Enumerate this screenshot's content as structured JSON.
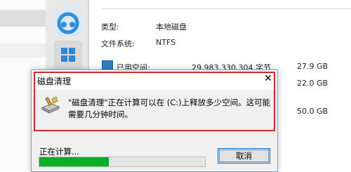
{
  "properties": {
    "type_label": "类型:",
    "type_value": "本地磁盘",
    "fs_label": "文件系统:",
    "fs_value": "NTFS",
    "used_label": "已用空间:",
    "used_bytes": "29,983,330,304 字节",
    "used_gb": "27.9 GB",
    "free_gb": "22.0 GB",
    "capacity_gb": "50.0 GB",
    "used_color": "#2f7fc6"
  },
  "dialog": {
    "title": "磁盘清理",
    "close_symbol": "✕",
    "message": "\"磁盘清理\"正在计算可以在 (C:)上释放多少空间。这可能需要几分钟时间。",
    "status_text": "正在计算...",
    "progress_fraction": 0.42,
    "progress_color": "#06b025",
    "cancel_label": "取消",
    "highlight_color": "#d6262a"
  },
  "icons": {
    "tile1": "cloud-icon",
    "tile2": "windows-icon",
    "dialog_icon": "disk-cleanup-icon"
  }
}
